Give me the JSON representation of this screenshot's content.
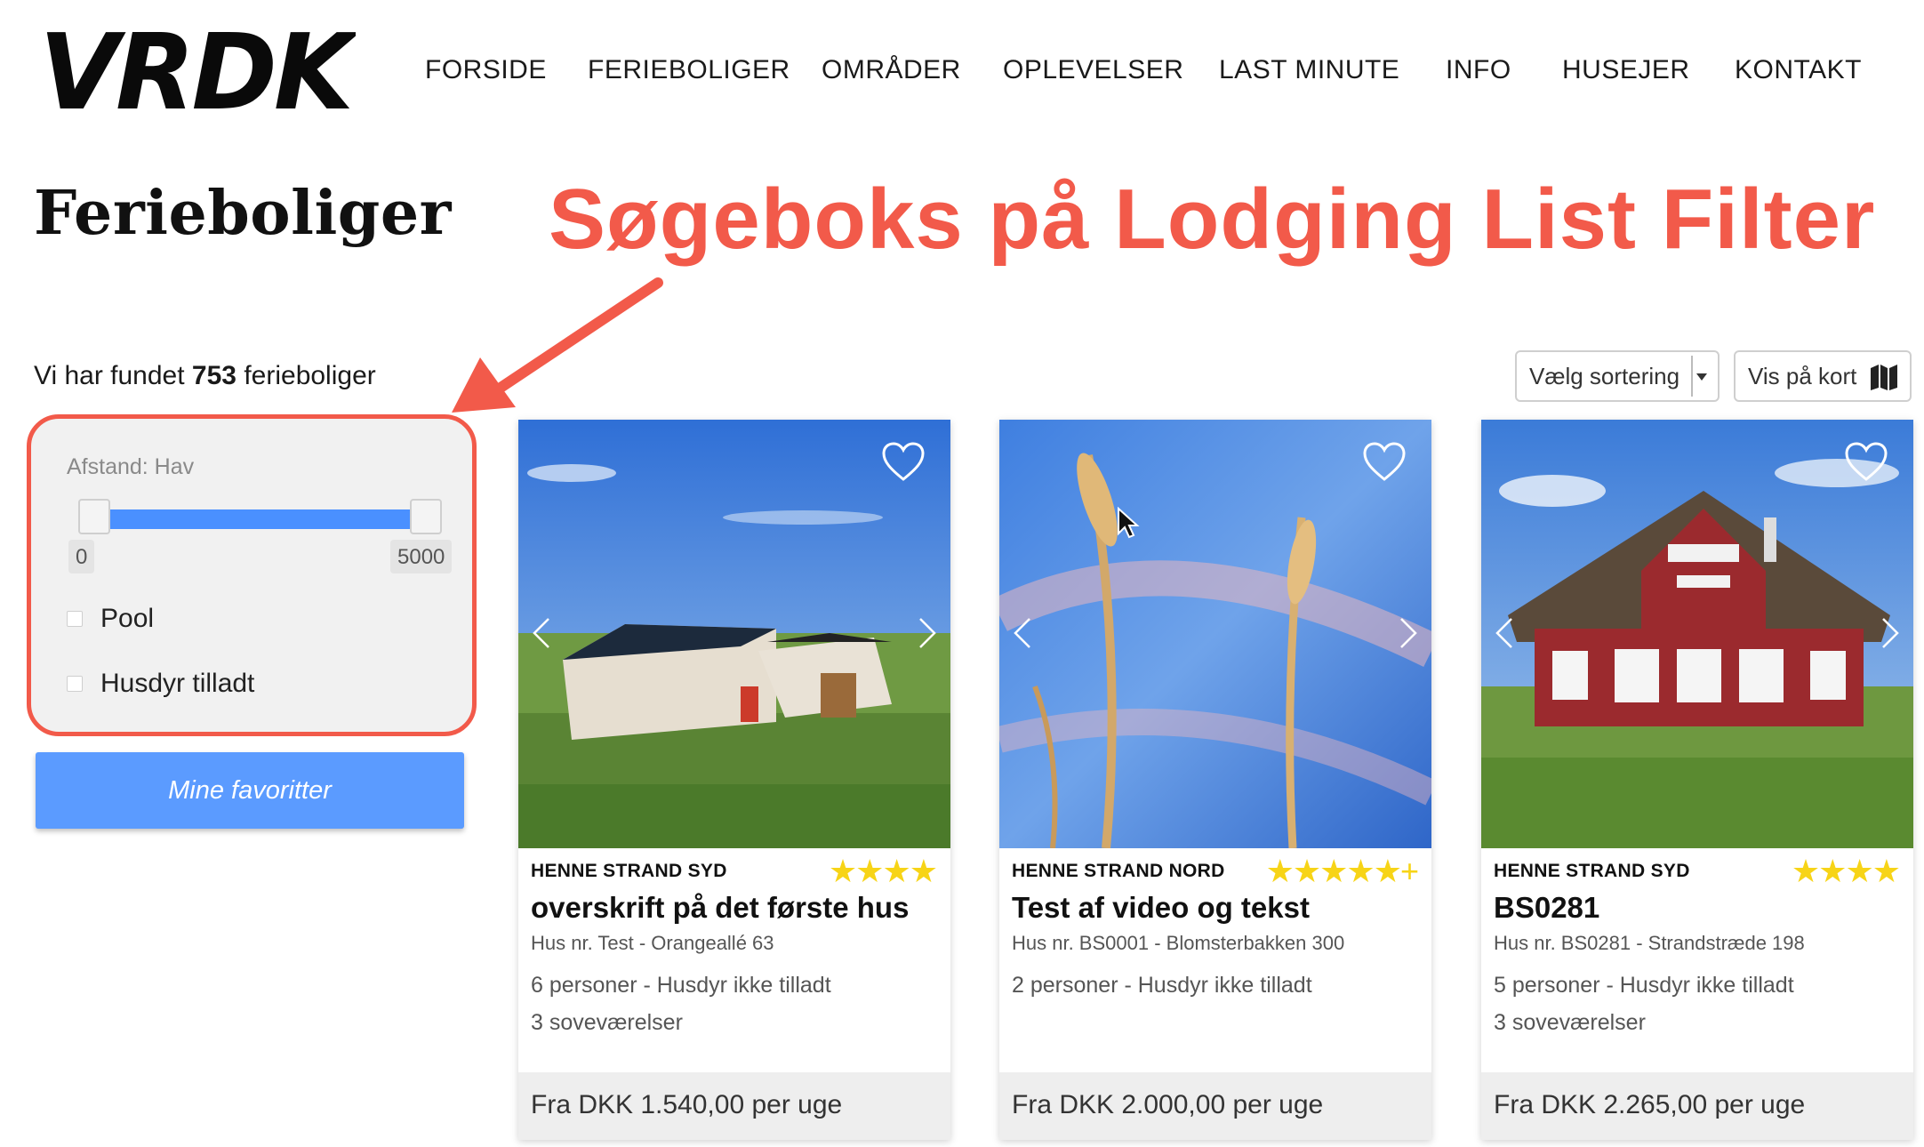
{
  "brand": {
    "logo_text": "VRDK"
  },
  "nav": {
    "items": [
      {
        "label": "FORSIDE"
      },
      {
        "label": "FERIEBOLIGER"
      },
      {
        "label": "OMRÅDER"
      },
      {
        "label": "OPLEVELSER"
      },
      {
        "label": "LAST MINUTE"
      },
      {
        "label": "INFO"
      },
      {
        "label": "HUSEJER"
      },
      {
        "label": "KONTAKT"
      }
    ]
  },
  "page": {
    "title": "Ferieboliger"
  },
  "annotation": {
    "text": "Søgeboks på Lodging List Filter",
    "color": "#f25a4a"
  },
  "results": {
    "prefix": "Vi har fundet",
    "count": "753",
    "suffix": "ferieboliger"
  },
  "toolbar": {
    "sort_label": "Vælg sortering",
    "map_label": "Vis på kort"
  },
  "filter": {
    "distance_label": "Afstand: Hav",
    "slider_min": "0",
    "slider_max": "5000",
    "options": [
      {
        "label": "Pool",
        "checked": false
      },
      {
        "label": "Husdyr tilladt",
        "checked": false
      }
    ]
  },
  "favorites_button": "Mine favoritter",
  "colors": {
    "accent": "#5b9bff",
    "slider": "#4a90ff",
    "star": "#f7d417",
    "highlight": "#f25a4a"
  },
  "cards": [
    {
      "area": "HENNE STRAND SYD",
      "stars": "★★★★",
      "rating": 4,
      "title": "overskrift på det første hus",
      "address": "Hus nr. Test - Orangeallé 63",
      "info1": "6 personer - Husdyr ikke tilladt",
      "info2": "3 soveværelser",
      "price": "Fra DKK 1.540,00 per uge"
    },
    {
      "area": "HENNE STRAND NORD",
      "stars": "★★★★★+",
      "rating": 5.5,
      "title": "Test af video og tekst",
      "address": "Hus nr. BS0001 - Blomsterbakken 300",
      "info1": "2 personer - Husdyr ikke tilladt",
      "info2": "",
      "price": "Fra DKK 2.000,00 per uge"
    },
    {
      "area": "HENNE STRAND SYD",
      "stars": "★★★★",
      "rating": 4,
      "title": "BS0281",
      "address": "Hus nr. BS0281 - Strandstræde 198",
      "info1": "5 personer - Husdyr ikke tilladt",
      "info2": "3 soveværelser",
      "price": "Fra DKK 2.265,00 per uge"
    }
  ]
}
